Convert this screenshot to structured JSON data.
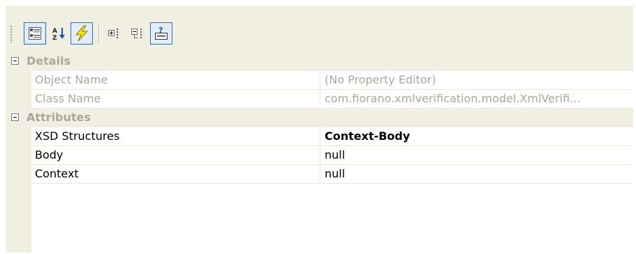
{
  "toolbar": {
    "buttons": [
      {
        "icon": "categorized-icon",
        "active": true
      },
      {
        "icon": "sort-alphabetical-icon",
        "active": false
      },
      {
        "icon": "events-lightning-icon",
        "active": true
      },
      {
        "icon": "expand-all-icon",
        "active": false
      },
      {
        "icon": "collapse-all-icon",
        "active": false
      },
      {
        "icon": "description-help-icon",
        "active": true
      }
    ]
  },
  "categories": [
    {
      "title": "Details",
      "properties": [
        {
          "name": "Object Name",
          "value": "(No Property Editor)",
          "readonly": true
        },
        {
          "name": "Class Name",
          "value": "com.fiorano.xmlverification.model.XmlVerifi...",
          "readonly": true
        }
      ]
    },
    {
      "title": "Attributes",
      "properties": [
        {
          "name": "XSD Structures",
          "value": "Context-Body",
          "bold": true
        },
        {
          "name": "Body",
          "value": "null"
        },
        {
          "name": "Context",
          "value": "null"
        }
      ]
    }
  ],
  "colors": {
    "panel": "#f1efe2",
    "grid_line": "#ece9d8",
    "readonly_text": "#aca899",
    "active_border": "#316ac5"
  }
}
